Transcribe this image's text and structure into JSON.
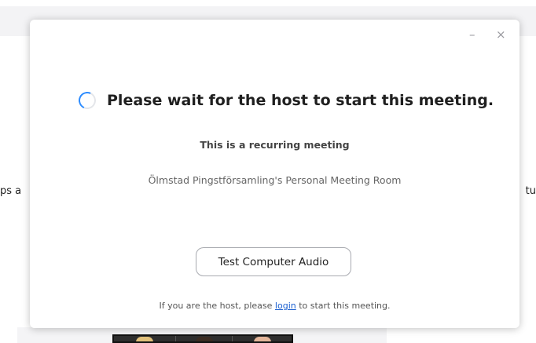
{
  "background": {
    "left_partial": "ps a",
    "right_partial": "tu"
  },
  "dialog": {
    "minimize": "–",
    "close": "×",
    "title": "Please wait for the host to start this meeting.",
    "recurring": "This is a recurring meeting",
    "room": "Ölmstad Pingstförsamling's Personal Meeting Room",
    "test_audio_button": "Test Computer Audio",
    "footer": {
      "before": "If you are the host, please ",
      "link": "login",
      "after": " to start this meeting."
    }
  },
  "colors": {
    "accent": "#2d8cff",
    "link": "#1a5fd0"
  }
}
